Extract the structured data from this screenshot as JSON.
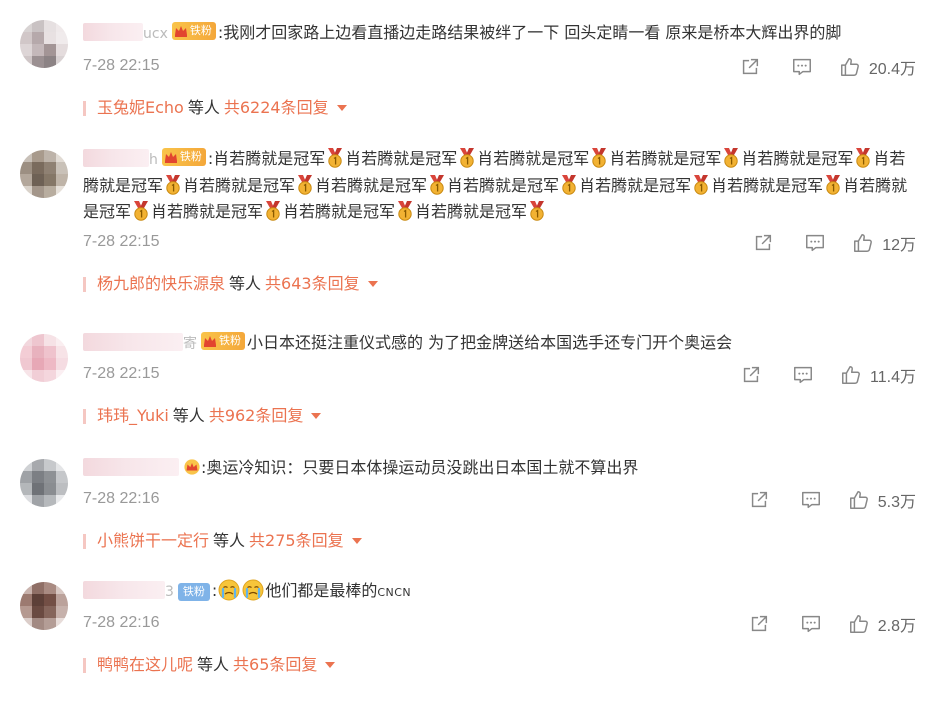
{
  "comments": [
    {
      "name_tail": "ucx",
      "badge": {
        "type": "gold",
        "label": "铁粉"
      },
      "text": ":我刚才回家路上边看直播边走路结果被绊了一下 回头定睛一看 原来是桥本大辉出界的脚",
      "time": "7-28 22:15",
      "likes": "20.4万",
      "reply": {
        "names": "玉兔妮Echo",
        "mid": "等人",
        "count": "共6224条回复"
      }
    },
    {
      "name_tail": "h",
      "badge": {
        "type": "gold",
        "label": "铁粉"
      },
      "phrase": "肖若腾就是冠军",
      "medal_icon": "gold-medal-icon",
      "time": "7-28 22:15",
      "likes": "12万",
      "reply": {
        "names": "杨九郎的快乐源泉",
        "mid": "等人",
        "count": "共643条回复"
      }
    },
    {
      "name_tail": "寄",
      "badge": {
        "type": "gold",
        "label": "铁粉"
      },
      "text": "小日本还挺注重仪式感的 为了把金牌送给本国选手还专门开个奥运会",
      "time": "7-28 22:15",
      "likes": "11.4万",
      "reply": {
        "names": "玮玮_Yuki",
        "mid": "等人",
        "count": "共962条回复"
      }
    },
    {
      "name_tail": "",
      "badge": {
        "type": "crown"
      },
      "text": ":奥运冷知识：只要日本体操运动员没跳出日本国土就不算出界",
      "time": "7-28 22:16",
      "likes": "5.3万",
      "reply": {
        "names": "小熊饼干一定行",
        "mid": "等人",
        "count": "共275条回复"
      }
    },
    {
      "name_tail": "3",
      "badge": {
        "type": "blue",
        "label": "铁粉"
      },
      "text_prefix": ":",
      "text": "他们都是最棒的",
      "text_suffix": "CNCN",
      "time": "7-28 22:16",
      "likes": "2.8万",
      "reply": {
        "names": "鸭鸭在这儿呢",
        "mid": "等人",
        "count": "共65条回复"
      }
    }
  ],
  "colors": {
    "accent": "#eb7350",
    "time": "#999999",
    "text": "#333333",
    "badge_gold": "#f4a73a",
    "badge_blue": "#7fb3e8"
  },
  "icons": [
    "share-icon",
    "comment-icon",
    "like-icon"
  ]
}
